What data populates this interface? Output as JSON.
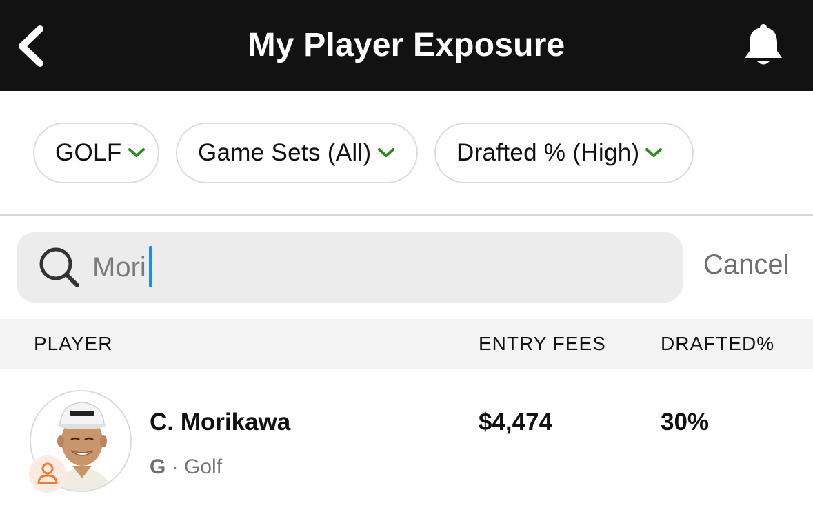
{
  "header": {
    "title": "My Player Exposure",
    "icons": {
      "back": "chevron-left-icon",
      "notifications": "bell-icon"
    }
  },
  "filters": {
    "sport": "GOLF",
    "game_sets": "Game Sets (All)",
    "sort": "Drafted % (High)",
    "chevron_color": "#2e8b1f"
  },
  "search": {
    "value": "Mori",
    "cancel_label": "Cancel",
    "caret_color": "#1a8fe8"
  },
  "table": {
    "columns": [
      "PLAYER",
      "ENTRY FEES",
      "DRAFTED%"
    ],
    "rows": [
      {
        "name": "C. Morikawa",
        "position": "G",
        "separator": "·",
        "sport": "Golf",
        "entry_fees": "$4,474",
        "drafted_pct": "30%"
      }
    ]
  },
  "colors": {
    "header_bg": "#121212",
    "badge_accent": "#f07a3a"
  }
}
